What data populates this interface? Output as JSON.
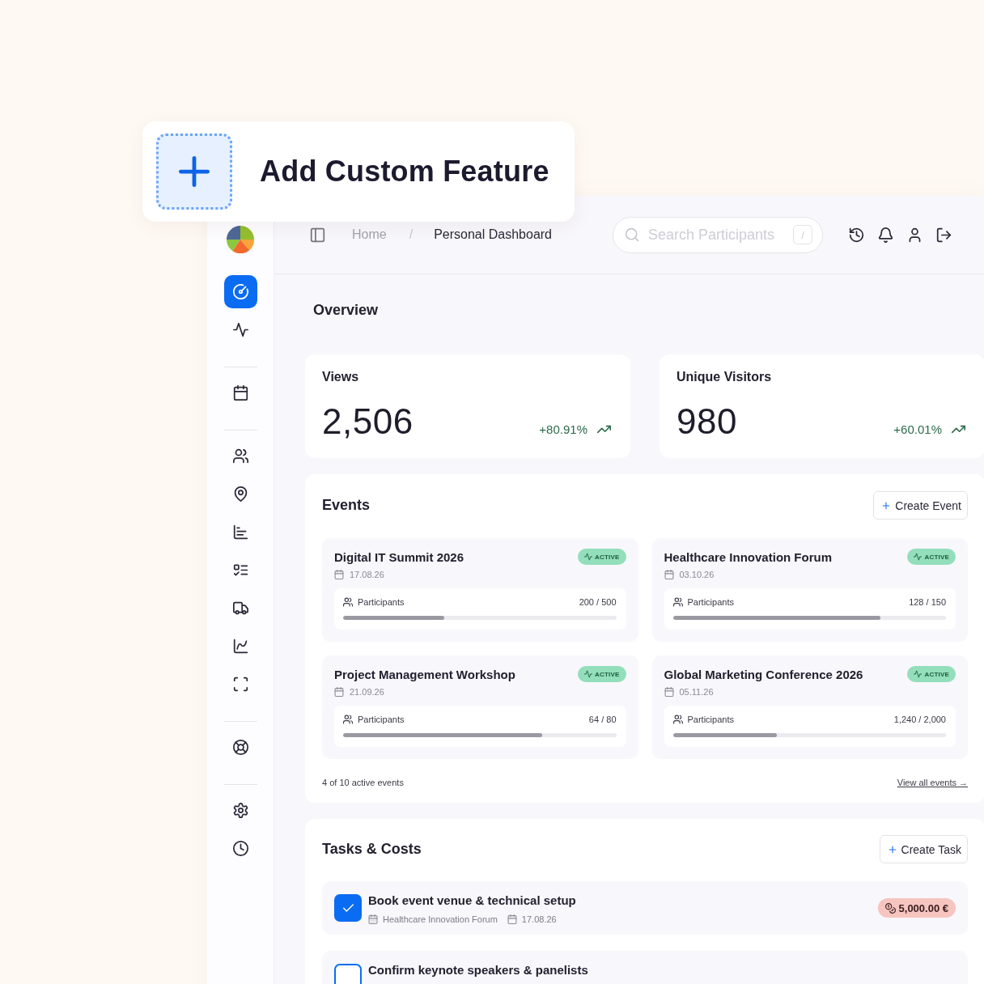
{
  "feature_card": {
    "title": "Add Custom Feature"
  },
  "sidebar": {
    "groups": [
      [
        {
          "selected": true
        },
        {
          "selected": false
        }
      ],
      [
        {
          "selected": false
        }
      ],
      [
        {
          "selected": false
        },
        {
          "selected": false
        },
        {
          "selected": false
        },
        {
          "selected": false
        },
        {
          "selected": false
        },
        {
          "selected": false
        },
        {
          "selected": false
        }
      ],
      [
        {
          "selected": false
        }
      ],
      [
        {
          "selected": false
        },
        {
          "selected": false
        }
      ]
    ]
  },
  "header": {
    "breadcrumb": {
      "items": [
        {
          "label": "Home",
          "current": false
        },
        {
          "label": "Personal Dashboard",
          "current": true
        }
      ],
      "separator": "/"
    },
    "search": {
      "placeholder": "Search Participants",
      "shortcut": "/"
    }
  },
  "overview": {
    "title": "Overview",
    "stats": [
      {
        "label": "Views",
        "value": "2,506",
        "change": "+80.91%",
        "rising": true
      },
      {
        "label": "Unique Visitors",
        "value": "980",
        "change": "+60.01%",
        "rising": true
      }
    ]
  },
  "events": {
    "title": "Events",
    "create_button": "Create Event",
    "items": [
      {
        "name": "Digital IT Summit 2026",
        "status": "ACTIVE",
        "date": "17.08.26",
        "participants_label": "Participants",
        "count": "200 / 500",
        "level": 0.37
      },
      {
        "name": "Healthcare Innovation Forum",
        "status": "ACTIVE",
        "date": "03.10.26",
        "participants_label": "Participants",
        "count": "128 / 150",
        "level": 0.76
      },
      {
        "name": "Project Management Workshop",
        "status": "ACTIVE",
        "date": "21.09.26",
        "participants_label": "Participants",
        "count": "64 / 80",
        "level": 0.73
      },
      {
        "name": "Global Marketing Conference 2026",
        "status": "ACTIVE",
        "date": "05.11.26",
        "participants_label": "Participants",
        "count": "1,240 / 2,000",
        "level": 0.38
      }
    ],
    "summary": "4 of 10 active events",
    "link": "View all events →"
  },
  "tasks": {
    "title": "Tasks & Costs",
    "create_button": "Create Task",
    "items": [
      {
        "title": "Book event venue & technical setup",
        "checked": true,
        "event": "Healthcare Innovation Forum",
        "date": "17.08.26",
        "cost": "5,000.00 €"
      },
      {
        "title": "Confirm keynote speakers & panelists",
        "checked": false
      }
    ]
  }
}
